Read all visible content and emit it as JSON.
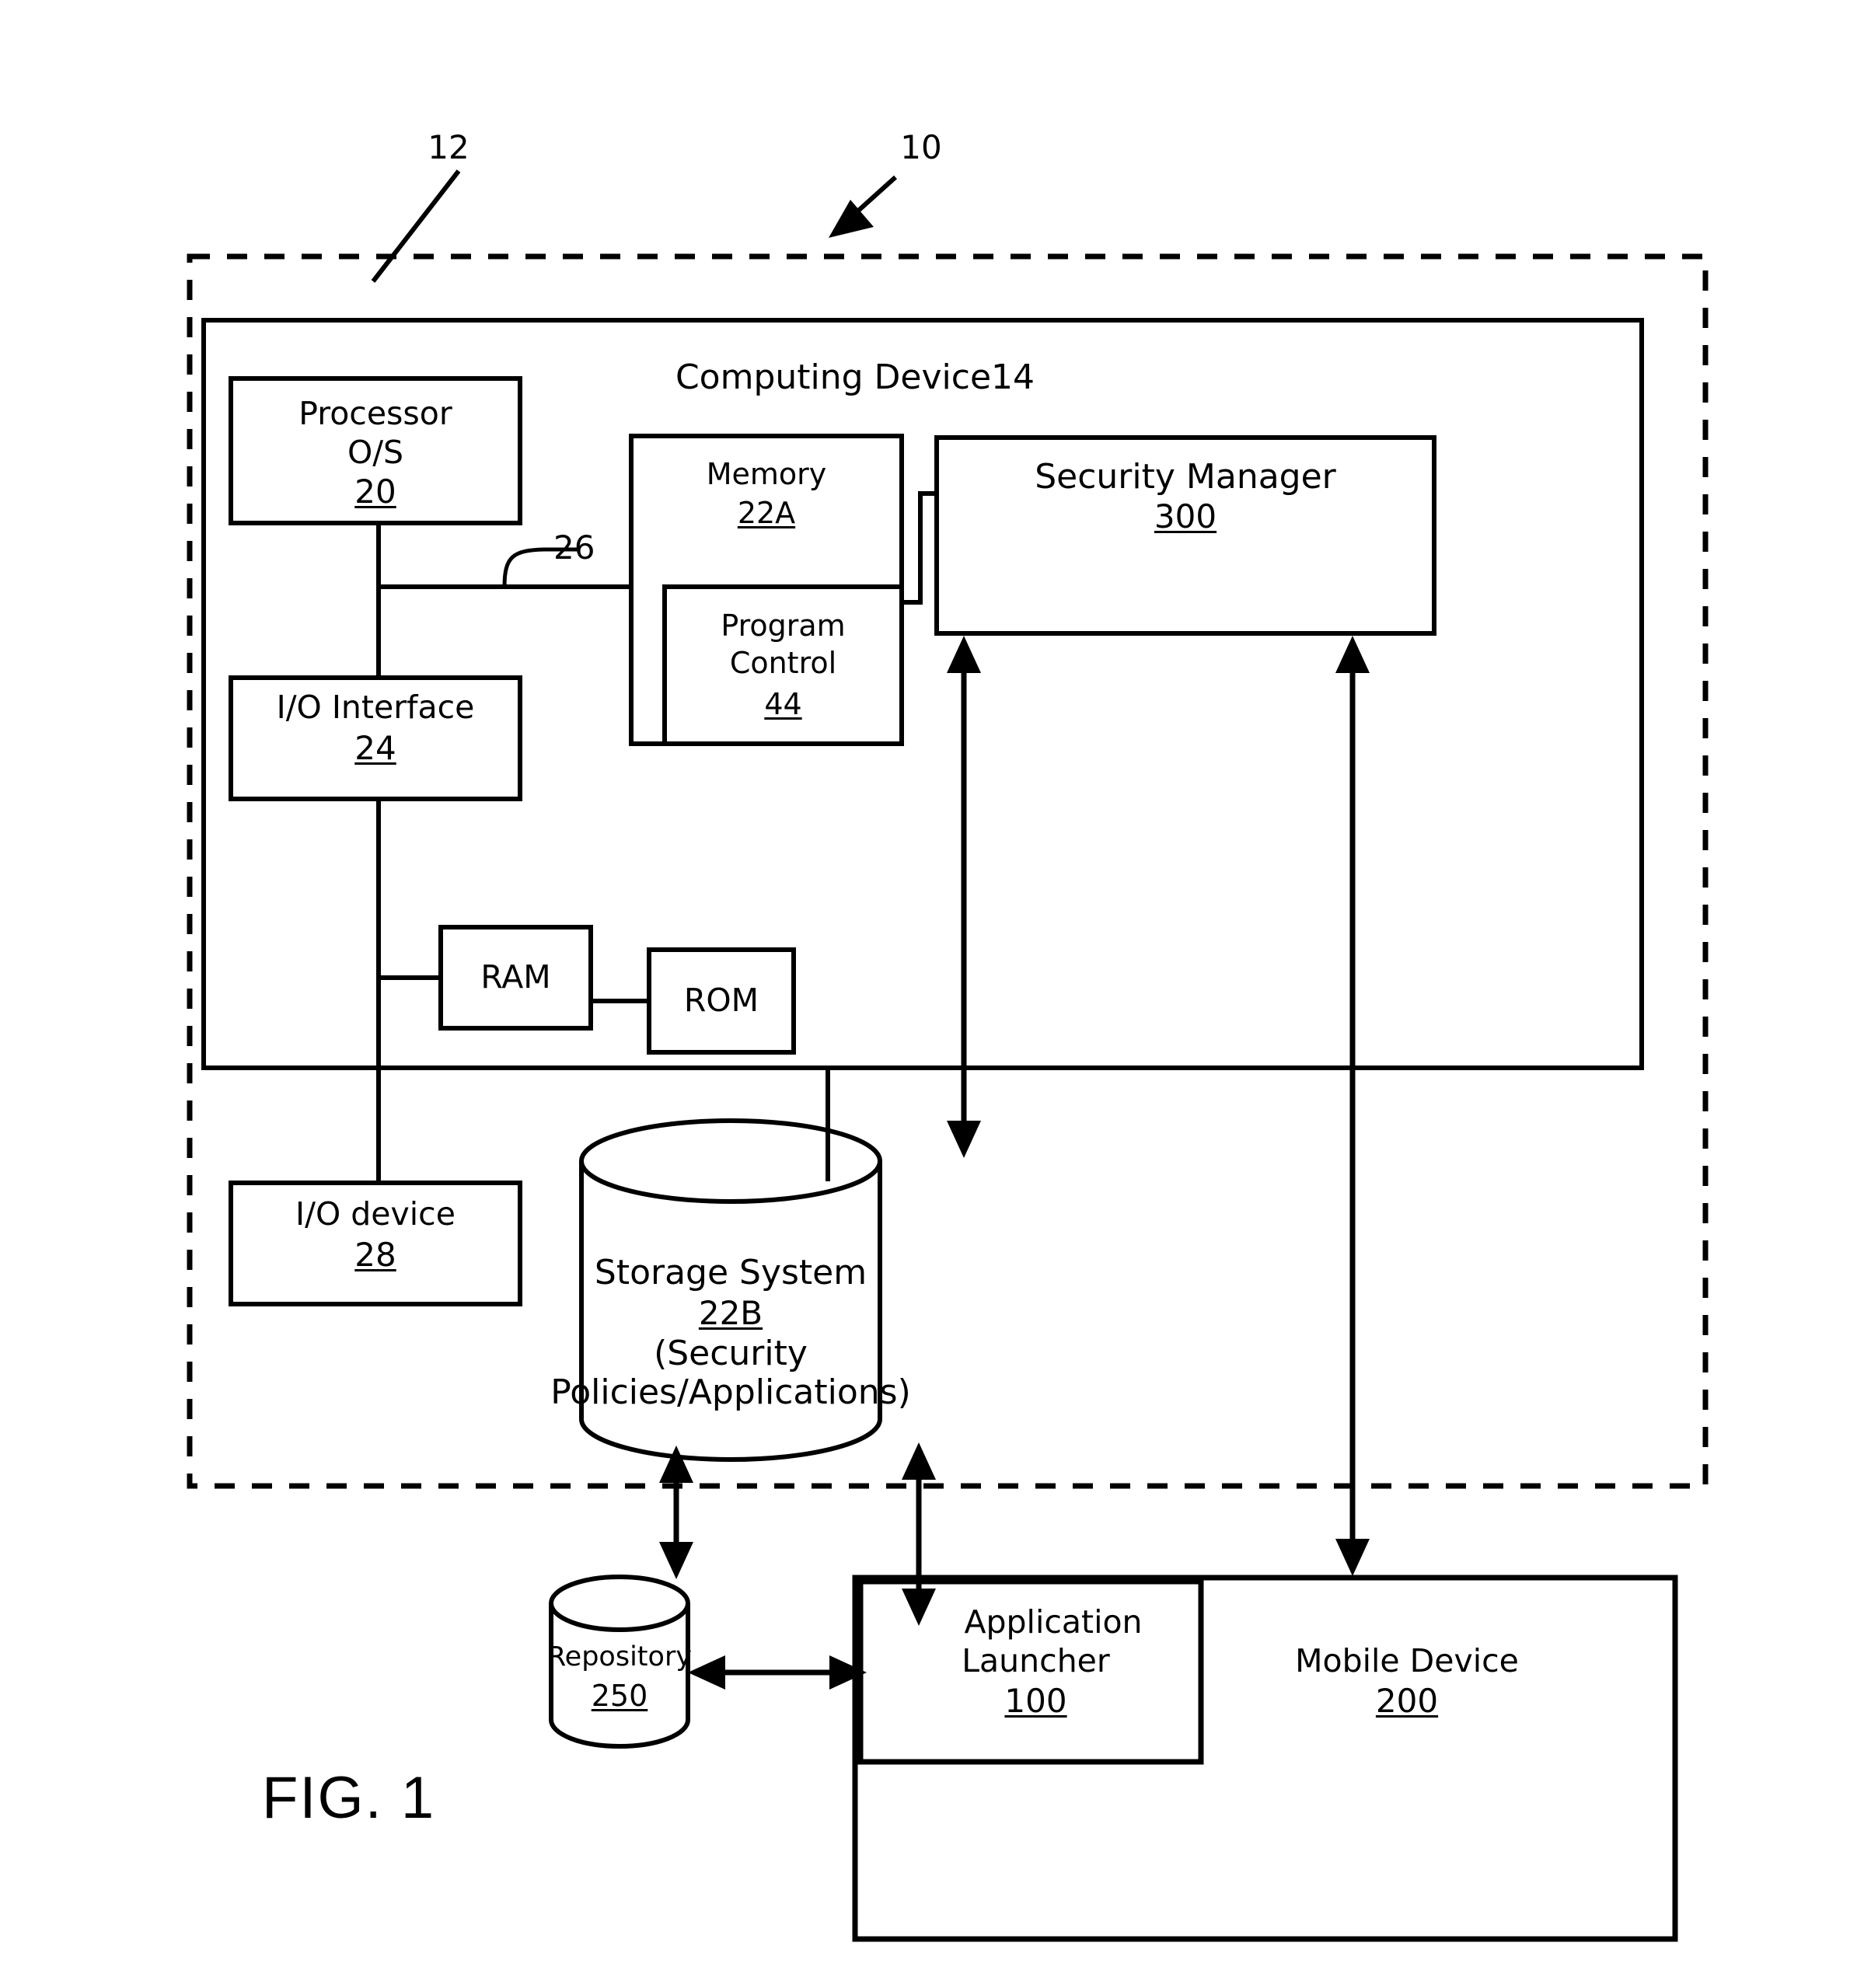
{
  "figure": {
    "name": "FIG. 1",
    "callouts": [
      {
        "id": "callout-12",
        "text": "12"
      },
      {
        "id": "callout-10",
        "text": "10"
      },
      {
        "id": "callout-26",
        "text": "26"
      }
    ],
    "environment_label": "",
    "computing_device": {
      "title": "Computing Device14",
      "blocks": [
        {
          "key": "processor",
          "line1": "Processor",
          "line2": "O/S",
          "ref": "20"
        },
        {
          "key": "io_interface",
          "line1": "I/O Interface",
          "line2": "",
          "ref": "24"
        },
        {
          "key": "memory",
          "line1": "Memory",
          "line2": "",
          "ref": "22A"
        },
        {
          "key": "program_control",
          "line1": "Program",
          "line2": "Control",
          "ref": "44"
        },
        {
          "key": "security_manager",
          "line1": "Security Manager",
          "line2": "",
          "ref": "300"
        },
        {
          "key": "ram",
          "line1": "RAM",
          "line2": "",
          "ref": ""
        },
        {
          "key": "rom",
          "line1": "ROM",
          "line2": "",
          "ref": ""
        }
      ]
    },
    "io_device": {
      "line1": "I/O device",
      "ref": "28"
    },
    "storage_system": {
      "line1": "Storage System",
      "ref": "22B",
      "line2": "(Security",
      "line3": "Policies/Applications)"
    },
    "repository": {
      "line1": "Repository",
      "ref": "250"
    },
    "application_launcher": {
      "line1": "Application",
      "line2": "Launcher",
      "ref": "100"
    },
    "mobile_device": {
      "line1": "Mobile Device",
      "ref": "200"
    }
  },
  "style": {
    "stroke": "#000000",
    "background": "#ffffff"
  }
}
